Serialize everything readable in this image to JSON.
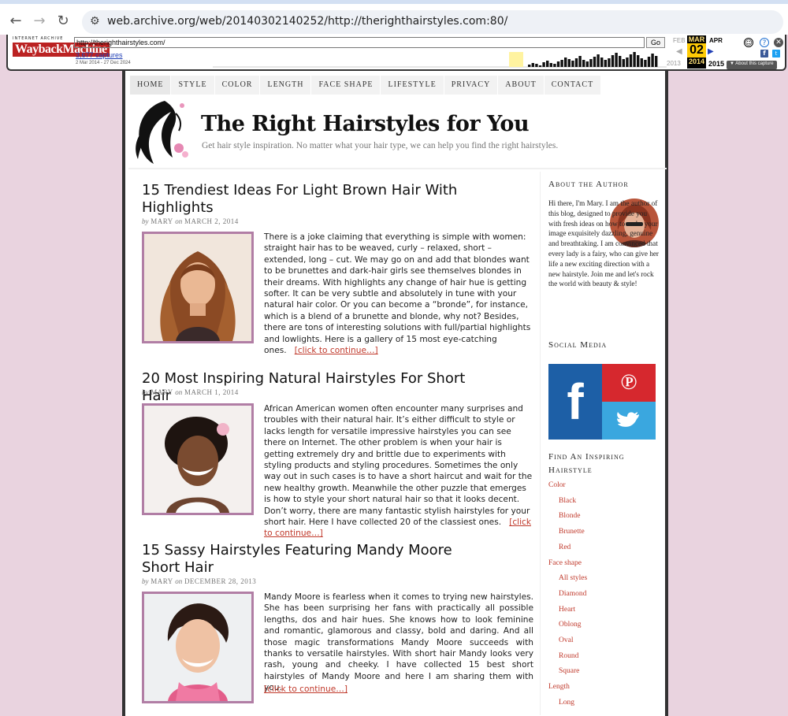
{
  "browser": {
    "url": "web.archive.org/web/20140302140252/http://therighthairstyles.com:80/",
    "back_icon": "arrow-left-icon",
    "forward_icon": "arrow-right-icon",
    "reload_icon": "reload-icon"
  },
  "wayback": {
    "logo_small": "INTERNET ARCHIVE",
    "logo_big": "WaybackMachine",
    "url_value": "http://therighthairstyles.com/",
    "go_label": "Go",
    "captures": "3,677 captures",
    "range": "2 Mar 2014 - 27 Dec 2024",
    "prev_month": "FEB",
    "cur_month": "MAR",
    "cur_day": "02",
    "cur_year": "2014",
    "next_month": "APR",
    "prev_year": "2013",
    "next_year": "2015",
    "about_capture": "▼ About this capture"
  },
  "site": {
    "menu": [
      "HOME",
      "STYLE",
      "COLOR",
      "LENGTH",
      "FACE SHAPE",
      "LIFESTYLE",
      "PRIVACY",
      "ABOUT",
      "CONTACT"
    ],
    "title": "The Right Hairstyles for You",
    "tagline": "Get hair style inspiration. No matter what your hair type, we can help you find the right hairstyles."
  },
  "posts": [
    {
      "title": "15 Trendiest Ideas For Light Brown Hair With Highlights",
      "by": "by",
      "author": "MARY",
      "on": "on",
      "date": "MARCH 2, 2014",
      "excerpt": "There is a joke claiming that everything is simple with women: straight hair has to be weaved, curly – relaxed, short – extended, long – cut. We may go on and add that blondes want to be brunettes and dark-hair girls see themselves blondes in their dreams. With highlights any change of hair hue is getting softer. It can be very subtle and absolutely in tune with your natural hair color. Or you can become a “bronde”, for instance, which is a blend of a brunette and blonde, why not? Besides, there are tons of interesting solutions with full/partial highlights and lowlights. Here is a gallery of 15 most eye-catching ones.",
      "more": "[click to continue…]"
    },
    {
      "title": "20 Most Inspiring Natural Hairstyles For Short Hair",
      "by": "by",
      "author": "MARY",
      "on": "on",
      "date": "MARCH 1, 2014",
      "excerpt": "African American women often encounter many surprises and troubles with their natural hair. It’s either difficult to style or lacks length for versatile impressive hairstyles you can see there on Internet. The other problem is when your hair is getting extremely dry and brittle due to experiments with styling products and styling procedures. Sometimes the only way out in such cases is to have a short haircut and wait for the new healthy growth. Meanwhile the other puzzle that emerges is how to style your short natural hair so that it looks decent. Don’t worry, there are many fantastic stylish hairstyles for your short hair. Here I have collected 20 of the classiest ones.",
      "more": "[click to continue…]"
    },
    {
      "title": "15 Sassy Hairstyles Featuring Mandy Moore Short Hair",
      "by": "by",
      "author": "MARY",
      "on": "on",
      "date": "DECEMBER 28, 2013",
      "excerpt": "Mandy Moore is fearless when it comes to trying new hairstyles. She has been surprising her fans with practically all possible lengths, dos and hair hues. She knows how to look feminine and romantic, glamorous and classy, bold and daring. And all those magic transformations Mandy Moore succeeds with thanks to versatile hairstyles. With short hair Mandy looks very rash, young and cheeky. I have collected 15 best short hairstyles of Mandy Moore and here I am sharing them with you.",
      "more": "[click to continue…]"
    }
  ],
  "sidebar": {
    "about_heading": "About the Author",
    "about_text": "Hi there, I'm Mary. I am the author of this blog, designed to provide you with fresh ideas on how to make your image exquisitely dazzling, genuine and breathtaking. I am convinced that every lady is a fairy, who can give her life a new exciting direction with a new hairstyle. Join me and let's rock the world with beauty & style!",
    "social_heading": "Social Media",
    "social_icons": [
      "facebook-icon",
      "pinterest-icon",
      "twitter-icon"
    ],
    "find_heading": "Find An Inspiring Hairstyle",
    "categories": [
      {
        "label": "Color",
        "level": 0
      },
      {
        "label": "Black",
        "level": 1
      },
      {
        "label": "Blonde",
        "level": 1
      },
      {
        "label": "Brunette",
        "level": 1
      },
      {
        "label": "Red",
        "level": 1
      },
      {
        "label": "Face shape",
        "level": 0
      },
      {
        "label": "All styles",
        "level": 1
      },
      {
        "label": "Diamond",
        "level": 1
      },
      {
        "label": "Heart",
        "level": 1
      },
      {
        "label": "Oblong",
        "level": 1
      },
      {
        "label": "Oval",
        "level": 1
      },
      {
        "label": "Round",
        "level": 1
      },
      {
        "label": "Square",
        "level": 1
      },
      {
        "label": "Length",
        "level": 0
      },
      {
        "label": "Long",
        "level": 1
      }
    ]
  },
  "colors": {
    "link_red": "#c0392b",
    "thumb_border": "#b17ea5",
    "facebook": "#1d5fa6",
    "pinterest": "#d6282e",
    "twitter": "#3aa7df"
  }
}
